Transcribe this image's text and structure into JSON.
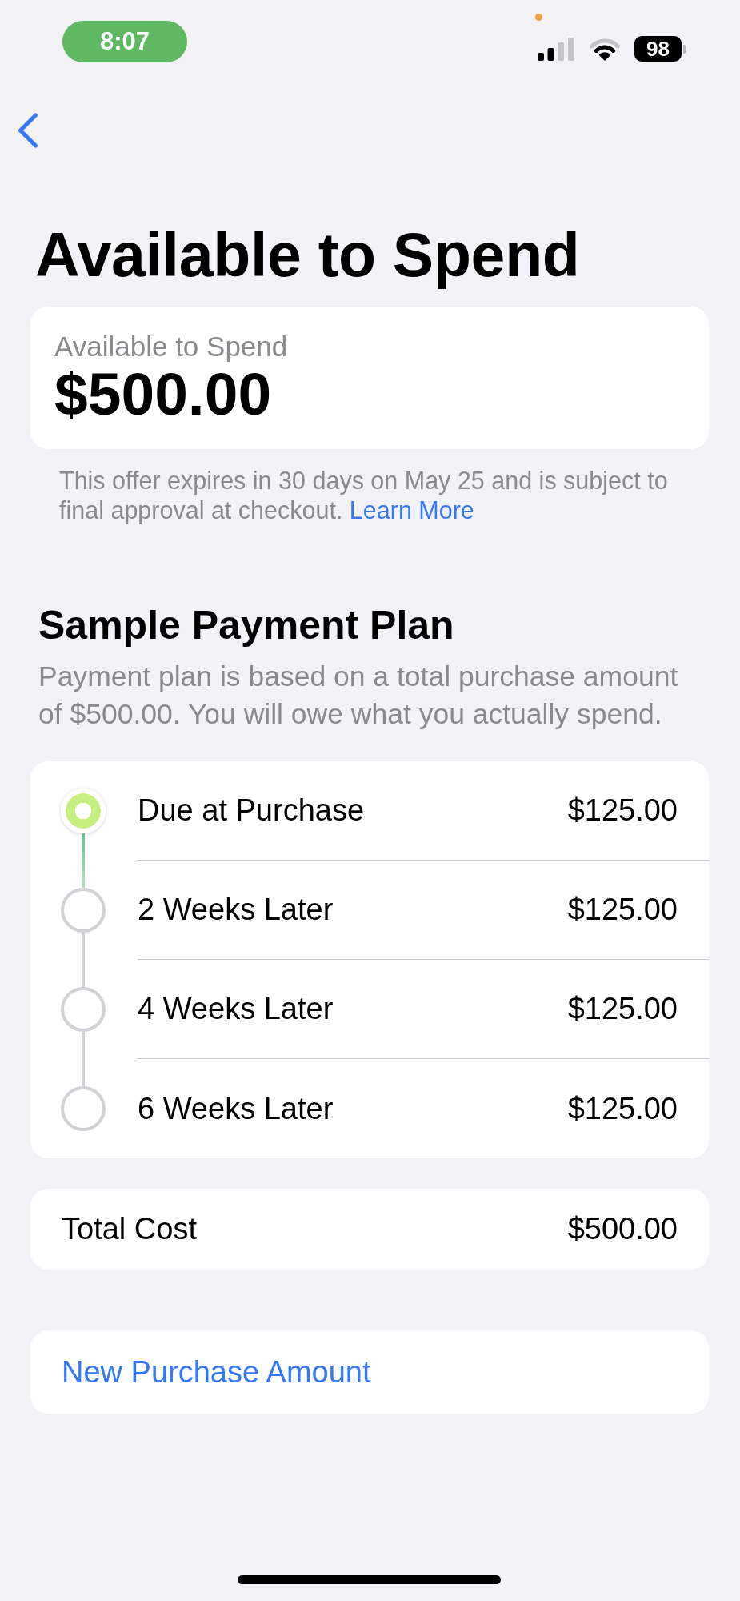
{
  "status_bar": {
    "time": "8:07",
    "battery": "98"
  },
  "title": "Available to Spend",
  "balance_card": {
    "label": "Available to Spend",
    "amount": "$500.00"
  },
  "offer_note": {
    "text": "This offer expires in 30 days on May 25 and is subject to final approval at checkout.",
    "link": "Learn More"
  },
  "payment_plan": {
    "heading": "Sample Payment Plan",
    "description": "Payment plan is based on a total purchase amount of $500.00. You will owe what you actually spend.",
    "payments": [
      {
        "label": "Due at Purchase",
        "amount": "$125.00",
        "current": true
      },
      {
        "label": "2 Weeks Later",
        "amount": "$125.00",
        "current": false
      },
      {
        "label": "4 Weeks Later",
        "amount": "$125.00",
        "current": false
      },
      {
        "label": "6 Weeks Later",
        "amount": "$125.00",
        "current": false
      }
    ]
  },
  "total": {
    "label": "Total Cost",
    "amount": "$500.00"
  },
  "actions": [
    {
      "label": "New Purchase Amount"
    }
  ]
}
